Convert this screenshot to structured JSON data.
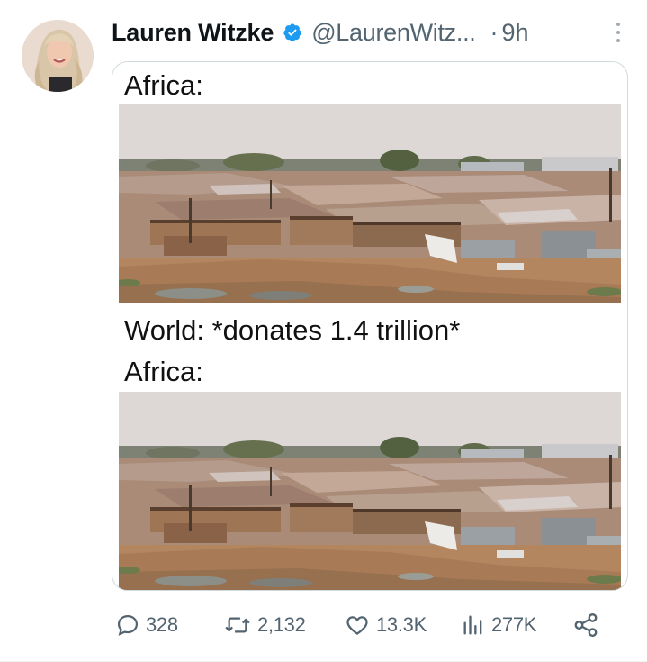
{
  "tweet": {
    "author_name": "Lauren Witzke",
    "handle": "@LaurenWitz...",
    "separator": "·",
    "time": "9h"
  },
  "media": {
    "caption_top": "Africa:",
    "caption_middle": "World: *donates 1.4 trillion*",
    "caption_bottom": "Africa:"
  },
  "actions": {
    "replies": "328",
    "reposts": "2,132",
    "likes": "13.3K",
    "views": "277K"
  },
  "colors": {
    "verified": "#1d9bf0",
    "secondary_text": "#536471",
    "border": "#cfd9de"
  },
  "icons": [
    "verified-badge-icon",
    "more-options-icon",
    "reply-icon",
    "repost-icon",
    "like-icon",
    "views-icon",
    "share-icon"
  ]
}
